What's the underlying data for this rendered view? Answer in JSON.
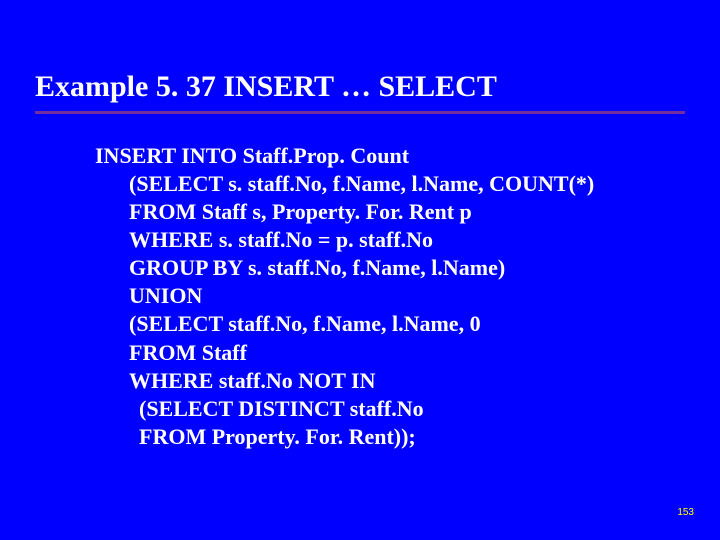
{
  "title": "Example 5. 37  INSERT … SELECT",
  "code": {
    "l0": "INSERT INTO Staff.Prop. Count",
    "l1": "(SELECT s. staff.No, f.Name, l.Name, COUNT(*)",
    "l2": "FROM Staff s, Property. For. Rent p",
    "l3": "WHERE s. staff.No = p. staff.No",
    "l4": "GROUP BY s. staff.No, f.Name, l.Name)",
    "l5": "UNION",
    "l6": "(SELECT staff.No, f.Name, l.Name, 0",
    "l7": "FROM Staff",
    "l8": "WHERE staff.No NOT IN",
    "l9": "(SELECT DISTINCT staff.No",
    "l10": "FROM Property. For. Rent));"
  },
  "page_number": "153"
}
